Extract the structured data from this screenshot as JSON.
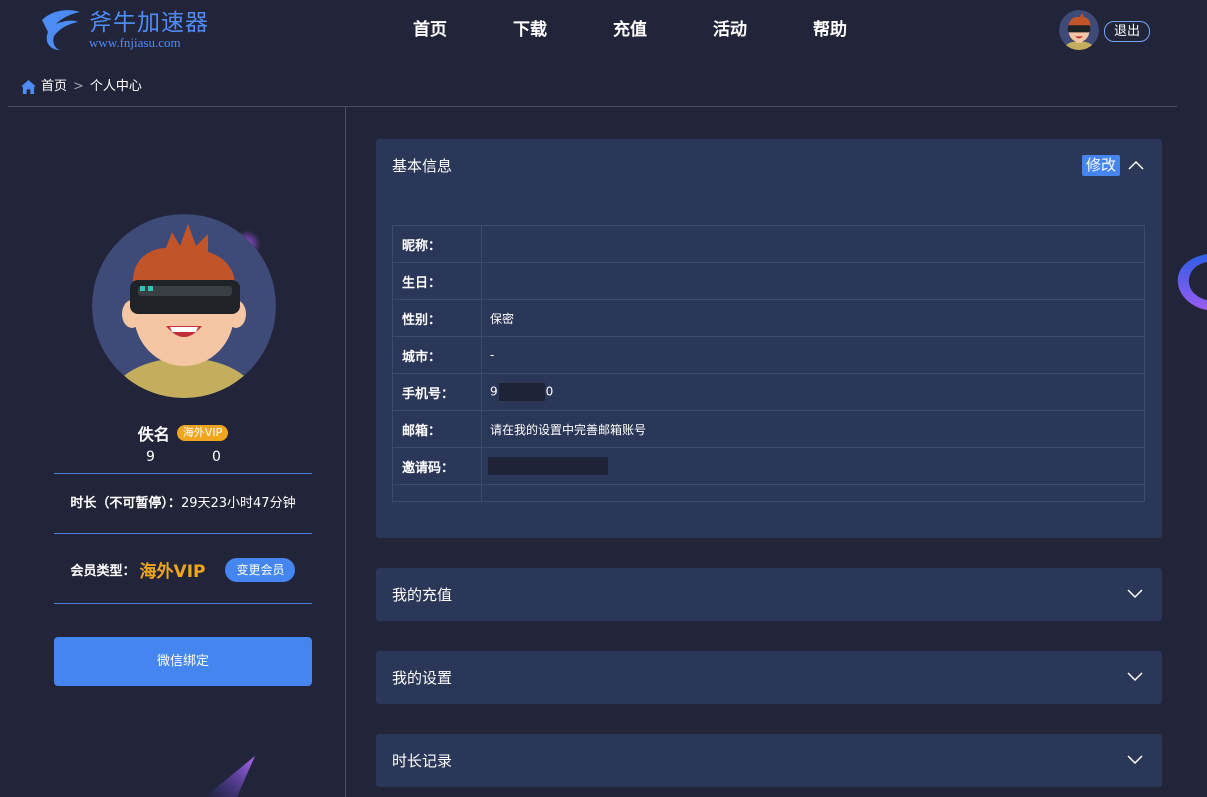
{
  "header": {
    "logo_title": "斧牛加速器",
    "logo_url": "www.fnjiasu.com",
    "nav": [
      "首页",
      "下载",
      "充值",
      "活动",
      "帮助"
    ],
    "logout_label": "退出"
  },
  "breadcrumb": {
    "home": "首页",
    "separator": ">",
    "current": "个人中心"
  },
  "profile": {
    "name": "佚名",
    "vip_badge": "海外VIP",
    "id_start": "9",
    "id_end": "0",
    "duration_label": "时长（不可暂停）：",
    "duration_value": "29天23小时47分钟",
    "member_label": "会员类型：",
    "member_value": "海外VIP",
    "change_member_label": "变更会员",
    "wechat_bind_label": "微信绑定"
  },
  "basic_info": {
    "title": "基本信息",
    "edit_label": "修改",
    "rows": [
      {
        "key": "昵称：",
        "value": ""
      },
      {
        "key": "生日：",
        "value": ""
      },
      {
        "key": "性别：",
        "value": "保密"
      },
      {
        "key": "城市：",
        "value": "-"
      },
      {
        "key": "手机号：",
        "value_start": "9",
        "value_end": "0"
      },
      {
        "key": "邮箱：",
        "value": "请在我的设置中完善邮箱账号"
      },
      {
        "key": "邀请码：",
        "value": ""
      }
    ]
  },
  "panels": [
    "我的充值",
    "我的设置",
    "时长记录"
  ],
  "colors": {
    "background": "#22253a",
    "panel": "#2a3758",
    "accent": "#4485f0",
    "vip": "#f0a51e"
  }
}
